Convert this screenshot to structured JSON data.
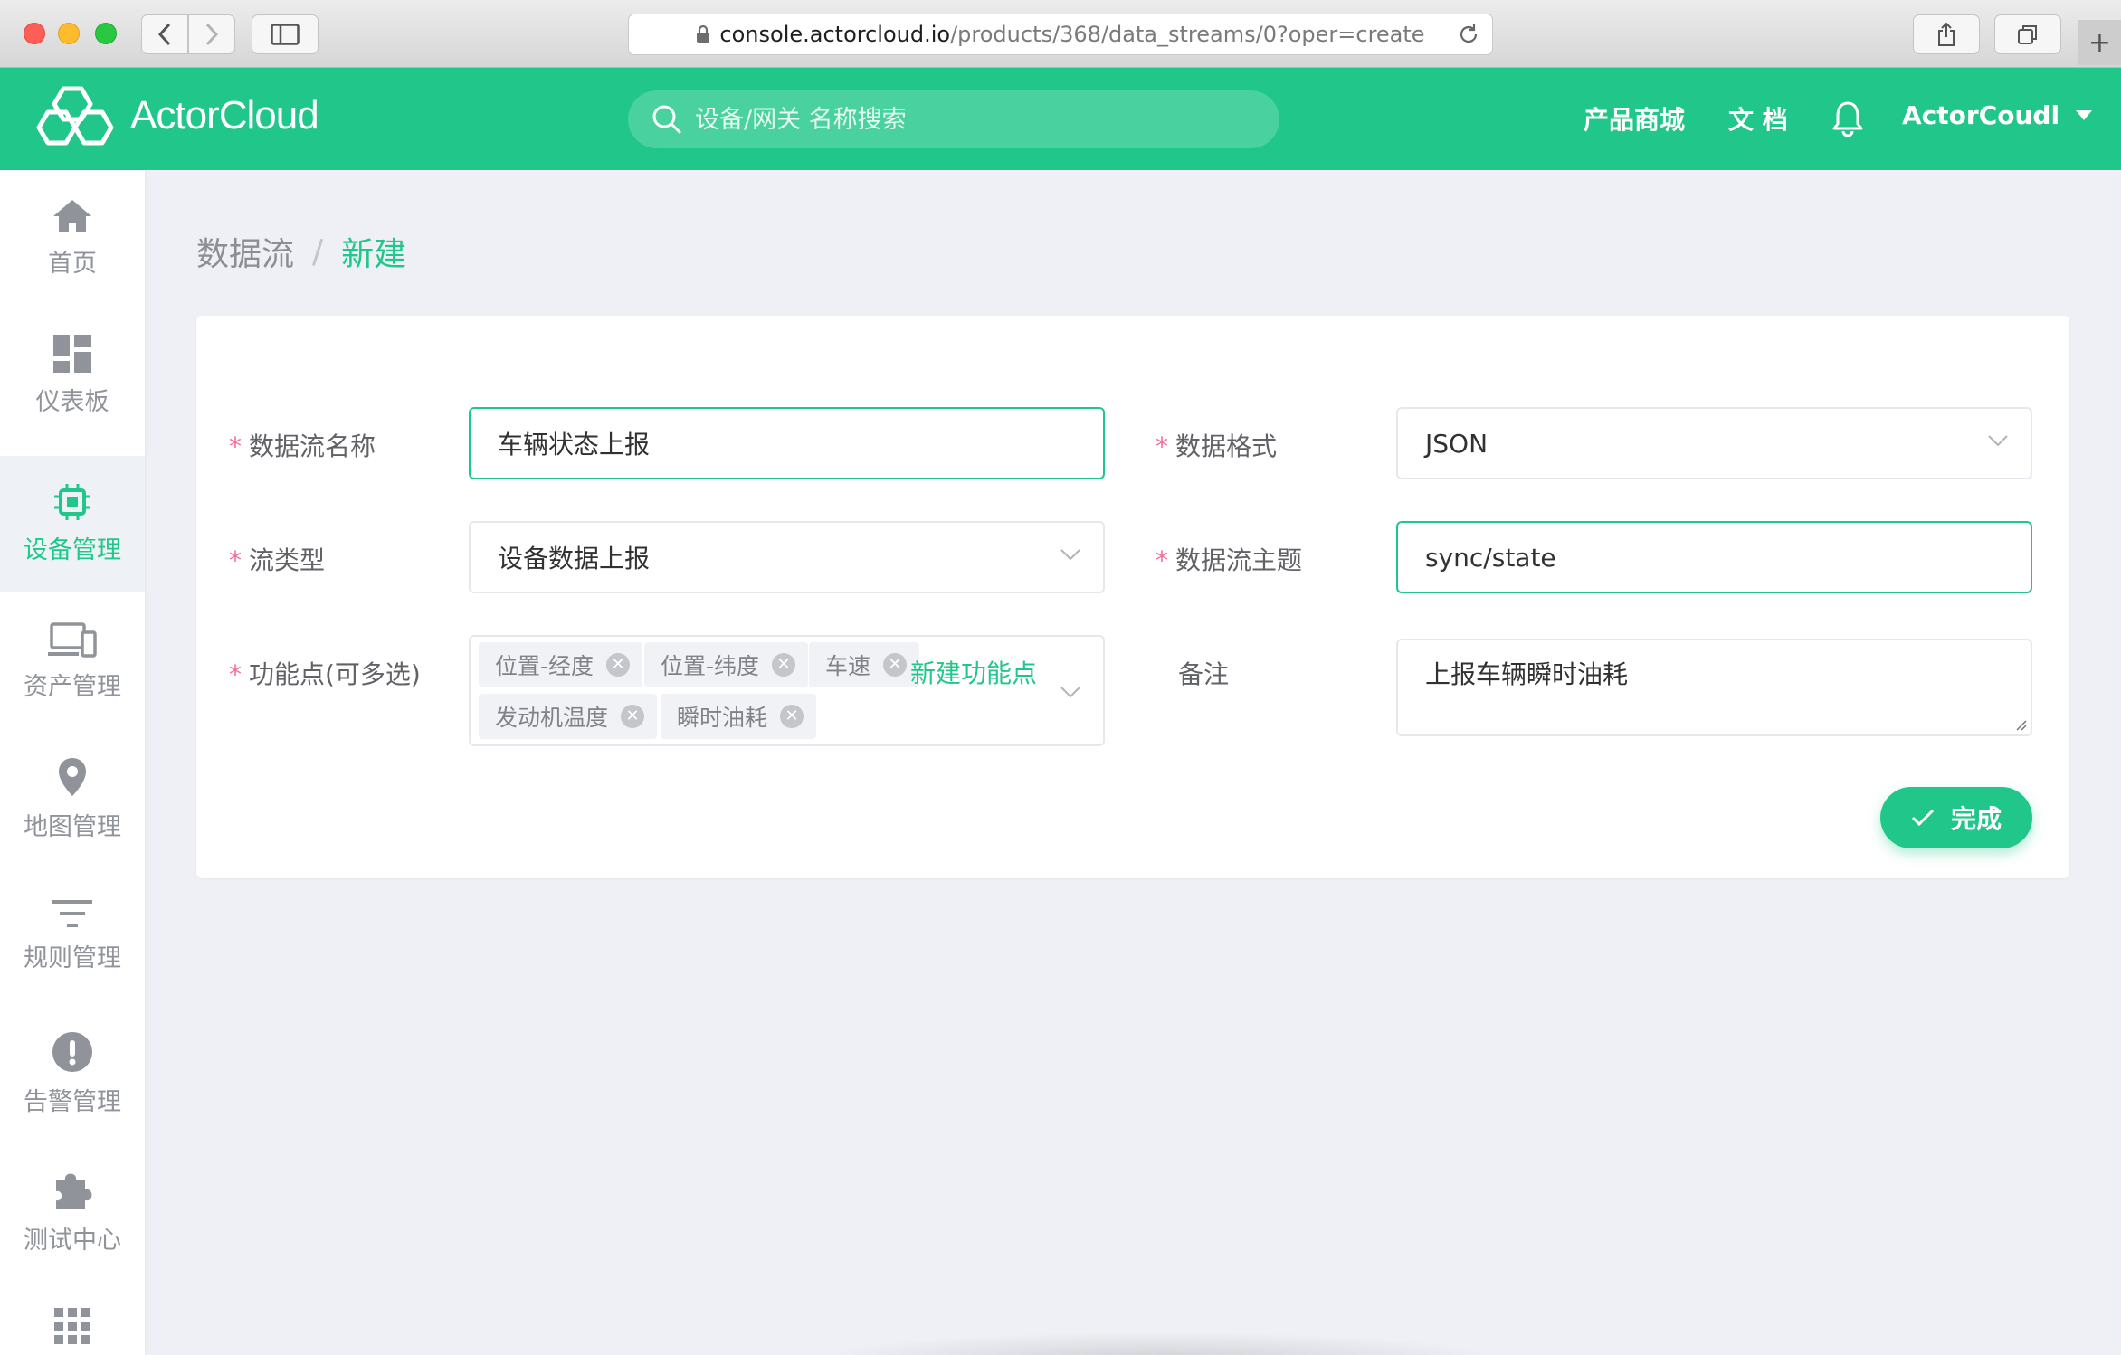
{
  "browser": {
    "url_host": "console.actorcloud.io",
    "url_path": "/products/368/data_streams/0?oper=create"
  },
  "header": {
    "logo_text": "ActorCloud",
    "search_placeholder": "设备/网关 名称搜索",
    "shop_link": "产品商城",
    "docs_link": "文 档",
    "user_name": "ActorCoudl"
  },
  "sidebar": {
    "items": [
      {
        "label": "首页",
        "icon": "home-icon"
      },
      {
        "label": "仪表板",
        "icon": "dashboard-icon"
      },
      {
        "label": "设备管理",
        "icon": "chip-icon",
        "active": true
      },
      {
        "label": "资产管理",
        "icon": "devices-icon"
      },
      {
        "label": "地图管理",
        "icon": "map-pin-icon"
      },
      {
        "label": "规则管理",
        "icon": "filter-icon"
      },
      {
        "label": "告警管理",
        "icon": "alert-icon"
      },
      {
        "label": "测试中心",
        "icon": "puzzle-icon"
      },
      {
        "label": "",
        "icon": "apps-grid-icon"
      }
    ]
  },
  "breadcrumb": {
    "parent": "数据流",
    "separator": "/",
    "current": "新建"
  },
  "form": {
    "required_mark": "*",
    "stream_name": {
      "label": "数据流名称",
      "value": "车辆状态上报"
    },
    "data_format": {
      "label": "数据格式",
      "value": "JSON"
    },
    "stream_type": {
      "label": "流类型",
      "value": "设备数据上报"
    },
    "stream_topic": {
      "label": "数据流主题",
      "value": "sync/state"
    },
    "function_points": {
      "label": "功能点(可多选)",
      "tags": [
        "位置-经度",
        "位置-纬度",
        "车速",
        "发动机温度",
        "瞬时油耗"
      ],
      "create_link": "新建功能点"
    },
    "remark": {
      "label": "备注",
      "value": "上报车辆瞬时油耗"
    },
    "submit_label": "完成"
  },
  "colors": {
    "brand": "#21c78a",
    "required": "#f56c9d",
    "page_bg": "#eef0f5"
  }
}
